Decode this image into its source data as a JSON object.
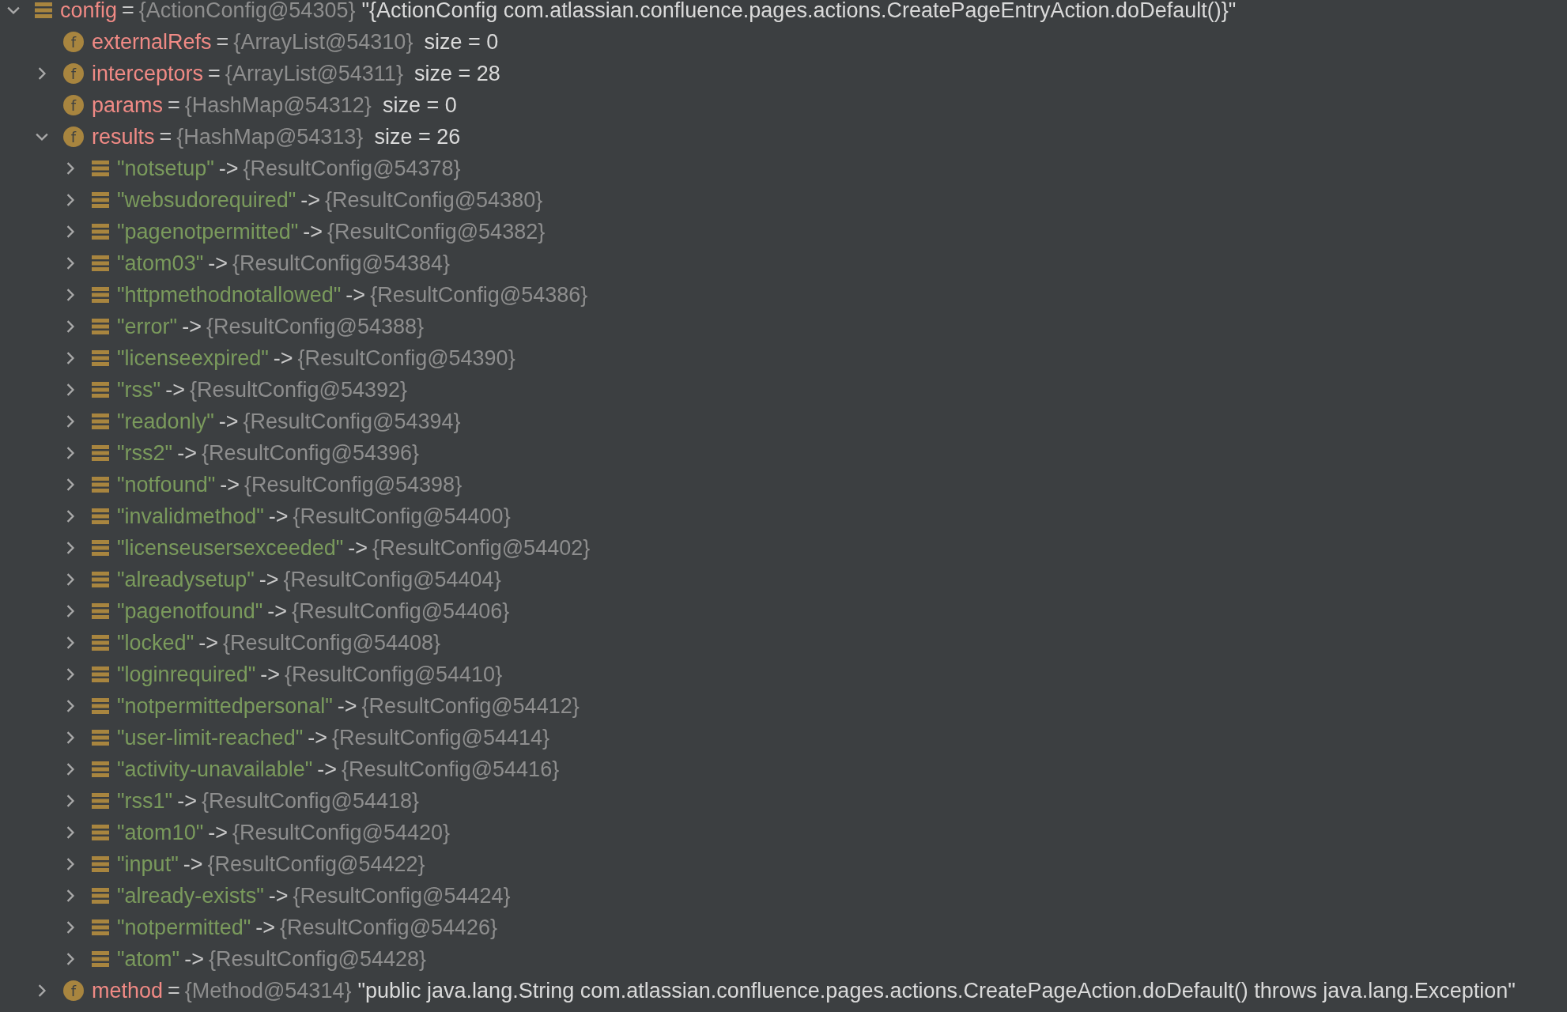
{
  "tree": [
    {
      "kind": "object",
      "name": "config",
      "op": "=",
      "type": "{ActionConfig@54305}",
      "value": "\"{ActionConfig com.atlassian.confluence.pages.actions.CreatePageEntryAction.doDefault()}\"",
      "expanded": true,
      "children": [
        {
          "kind": "field",
          "badge": "f",
          "name": "externalRefs",
          "op": "=",
          "type": "{ArrayList@54310}",
          "size": "size = 0"
        },
        {
          "kind": "field",
          "badge": "f",
          "name": "interceptors",
          "op": "=",
          "type": "{ArrayList@54311}",
          "size": "size = 28",
          "expanded": false
        },
        {
          "kind": "field",
          "badge": "f",
          "name": "params",
          "op": "=",
          "type": "{HashMap@54312}",
          "size": "size = 0"
        },
        {
          "kind": "field",
          "badge": "f",
          "name": "results",
          "op": "=",
          "type": "{HashMap@54313}",
          "size": "size = 26",
          "expanded": true,
          "children": [
            {
              "kind": "entry",
              "name": "\"notsetup\"",
              "arrow": "->",
              "type": "{ResultConfig@54378}",
              "expanded": false
            },
            {
              "kind": "entry",
              "name": "\"websudorequired\"",
              "arrow": "->",
              "type": "{ResultConfig@54380}",
              "expanded": false
            },
            {
              "kind": "entry",
              "name": "\"pagenotpermitted\"",
              "arrow": "->",
              "type": "{ResultConfig@54382}",
              "expanded": false
            },
            {
              "kind": "entry",
              "name": "\"atom03\"",
              "arrow": "->",
              "type": "{ResultConfig@54384}",
              "expanded": false
            },
            {
              "kind": "entry",
              "name": "\"httpmethodnotallowed\"",
              "arrow": "->",
              "type": "{ResultConfig@54386}",
              "expanded": false
            },
            {
              "kind": "entry",
              "name": "\"error\"",
              "arrow": "->",
              "type": "{ResultConfig@54388}",
              "expanded": false
            },
            {
              "kind": "entry",
              "name": "\"licenseexpired\"",
              "arrow": "->",
              "type": "{ResultConfig@54390}",
              "expanded": false
            },
            {
              "kind": "entry",
              "name": "\"rss\"",
              "arrow": "->",
              "type": "{ResultConfig@54392}",
              "expanded": false
            },
            {
              "kind": "entry",
              "name": "\"readonly\"",
              "arrow": "->",
              "type": "{ResultConfig@54394}",
              "expanded": false
            },
            {
              "kind": "entry",
              "name": "\"rss2\"",
              "arrow": "->",
              "type": "{ResultConfig@54396}",
              "expanded": false
            },
            {
              "kind": "entry",
              "name": "\"notfound\"",
              "arrow": "->",
              "type": "{ResultConfig@54398}",
              "expanded": false
            },
            {
              "kind": "entry",
              "name": "\"invalidmethod\"",
              "arrow": "->",
              "type": "{ResultConfig@54400}",
              "expanded": false
            },
            {
              "kind": "entry",
              "name": "\"licenseusersexceeded\"",
              "arrow": "->",
              "type": "{ResultConfig@54402}",
              "expanded": false
            },
            {
              "kind": "entry",
              "name": "\"alreadysetup\"",
              "arrow": "->",
              "type": "{ResultConfig@54404}",
              "expanded": false
            },
            {
              "kind": "entry",
              "name": "\"pagenotfound\"",
              "arrow": "->",
              "type": "{ResultConfig@54406}",
              "expanded": false
            },
            {
              "kind": "entry",
              "name": "\"locked\"",
              "arrow": "->",
              "type": "{ResultConfig@54408}",
              "expanded": false
            },
            {
              "kind": "entry",
              "name": "\"loginrequired\"",
              "arrow": "->",
              "type": "{ResultConfig@54410}",
              "expanded": false
            },
            {
              "kind": "entry",
              "name": "\"notpermittedpersonal\"",
              "arrow": "->",
              "type": "{ResultConfig@54412}",
              "expanded": false
            },
            {
              "kind": "entry",
              "name": "\"user-limit-reached\"",
              "arrow": "->",
              "type": "{ResultConfig@54414}",
              "expanded": false
            },
            {
              "kind": "entry",
              "name": "\"activity-unavailable\"",
              "arrow": "->",
              "type": "{ResultConfig@54416}",
              "expanded": false
            },
            {
              "kind": "entry",
              "name": "\"rss1\"",
              "arrow": "->",
              "type": "{ResultConfig@54418}",
              "expanded": false
            },
            {
              "kind": "entry",
              "name": "\"atom10\"",
              "arrow": "->",
              "type": "{ResultConfig@54420}",
              "expanded": false
            },
            {
              "kind": "entry",
              "name": "\"input\"",
              "arrow": "->",
              "type": "{ResultConfig@54422}",
              "expanded": false
            },
            {
              "kind": "entry",
              "name": "\"already-exists\"",
              "arrow": "->",
              "type": "{ResultConfig@54424}",
              "expanded": false
            },
            {
              "kind": "entry",
              "name": "\"notpermitted\"",
              "arrow": "->",
              "type": "{ResultConfig@54426}",
              "expanded": false
            },
            {
              "kind": "entry",
              "name": "\"atom\"",
              "arrow": "->",
              "type": "{ResultConfig@54428}",
              "expanded": false
            }
          ]
        },
        {
          "kind": "field",
          "badge": "f",
          "name": "method",
          "op": "=",
          "type": "{Method@54314}",
          "value": "\"public java.lang.String com.atlassian.confluence.pages.actions.CreatePageAction.doDefault() throws java.lang.Exception\"",
          "expanded": false
        }
      ]
    }
  ]
}
